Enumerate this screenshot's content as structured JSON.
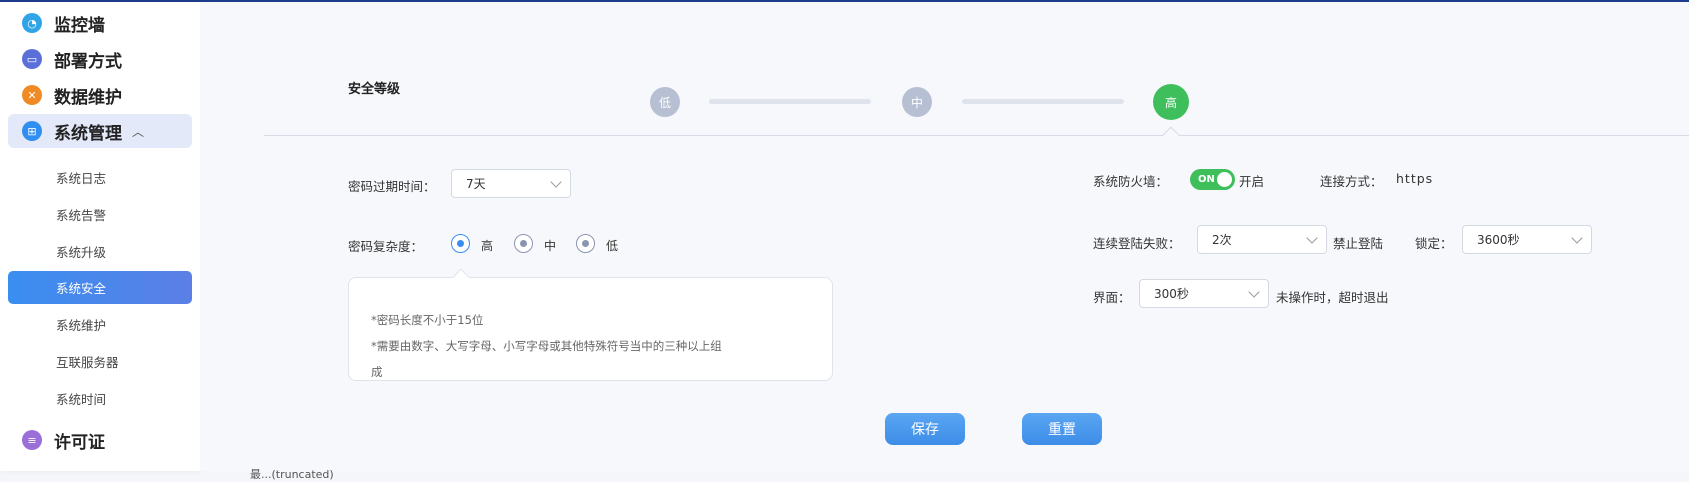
{
  "sidebar": {
    "top_items": [
      {
        "label": "监控墙",
        "icon": "dashboard-icon",
        "color": "#2fa4e7"
      },
      {
        "label": "部署方式",
        "icon": "monitor-icon",
        "color": "#5b6fd8"
      },
      {
        "label": "数据维护",
        "icon": "tools-icon",
        "color": "#f08a24"
      },
      {
        "label": "系统管理",
        "icon": "windows-icon",
        "color": "#2f8ef0"
      }
    ],
    "sub_items": [
      "系统日志",
      "系统告警",
      "系统升级",
      "系统安全",
      "系统维护",
      "互联服务器",
      "系统时间"
    ],
    "active_sub": "系统安全",
    "bottom_item": {
      "label": "许可证",
      "icon": "license-icon",
      "color": "#9b6fd8"
    }
  },
  "security_level": {
    "title": "安全等级",
    "steps": [
      "低",
      "中",
      "高"
    ],
    "selected": "高"
  },
  "password": {
    "expire_label": "密码过期时间：",
    "expire_value": "7天",
    "complexity_label": "密码复杂度：",
    "complexity_options": [
      "高",
      "中",
      "低"
    ],
    "complexity_selected": "高",
    "tips": [
      "*密码长度不小于15位",
      "*需要由数字、大写字母、小写字母或其他特殊符号当中的三种以上组",
      "成"
    ]
  },
  "firewall": {
    "label": "系统防火墙：",
    "toggle_text": "ON",
    "state_text": "开启",
    "connect_label": "连接方式：",
    "connect_value": "https"
  },
  "login_fail": {
    "label": "连续登陆失败：",
    "count_value": "2次",
    "action_text": "禁止登陆",
    "lock_label": "锁定：",
    "lock_value": "3600秒"
  },
  "ui_timeout": {
    "label": "界面：",
    "value": "300秒",
    "suffix": "未操作时，超时退出"
  },
  "buttons": {
    "save": "保存",
    "reset": "重置"
  },
  "footnote": "最...(truncated)"
}
